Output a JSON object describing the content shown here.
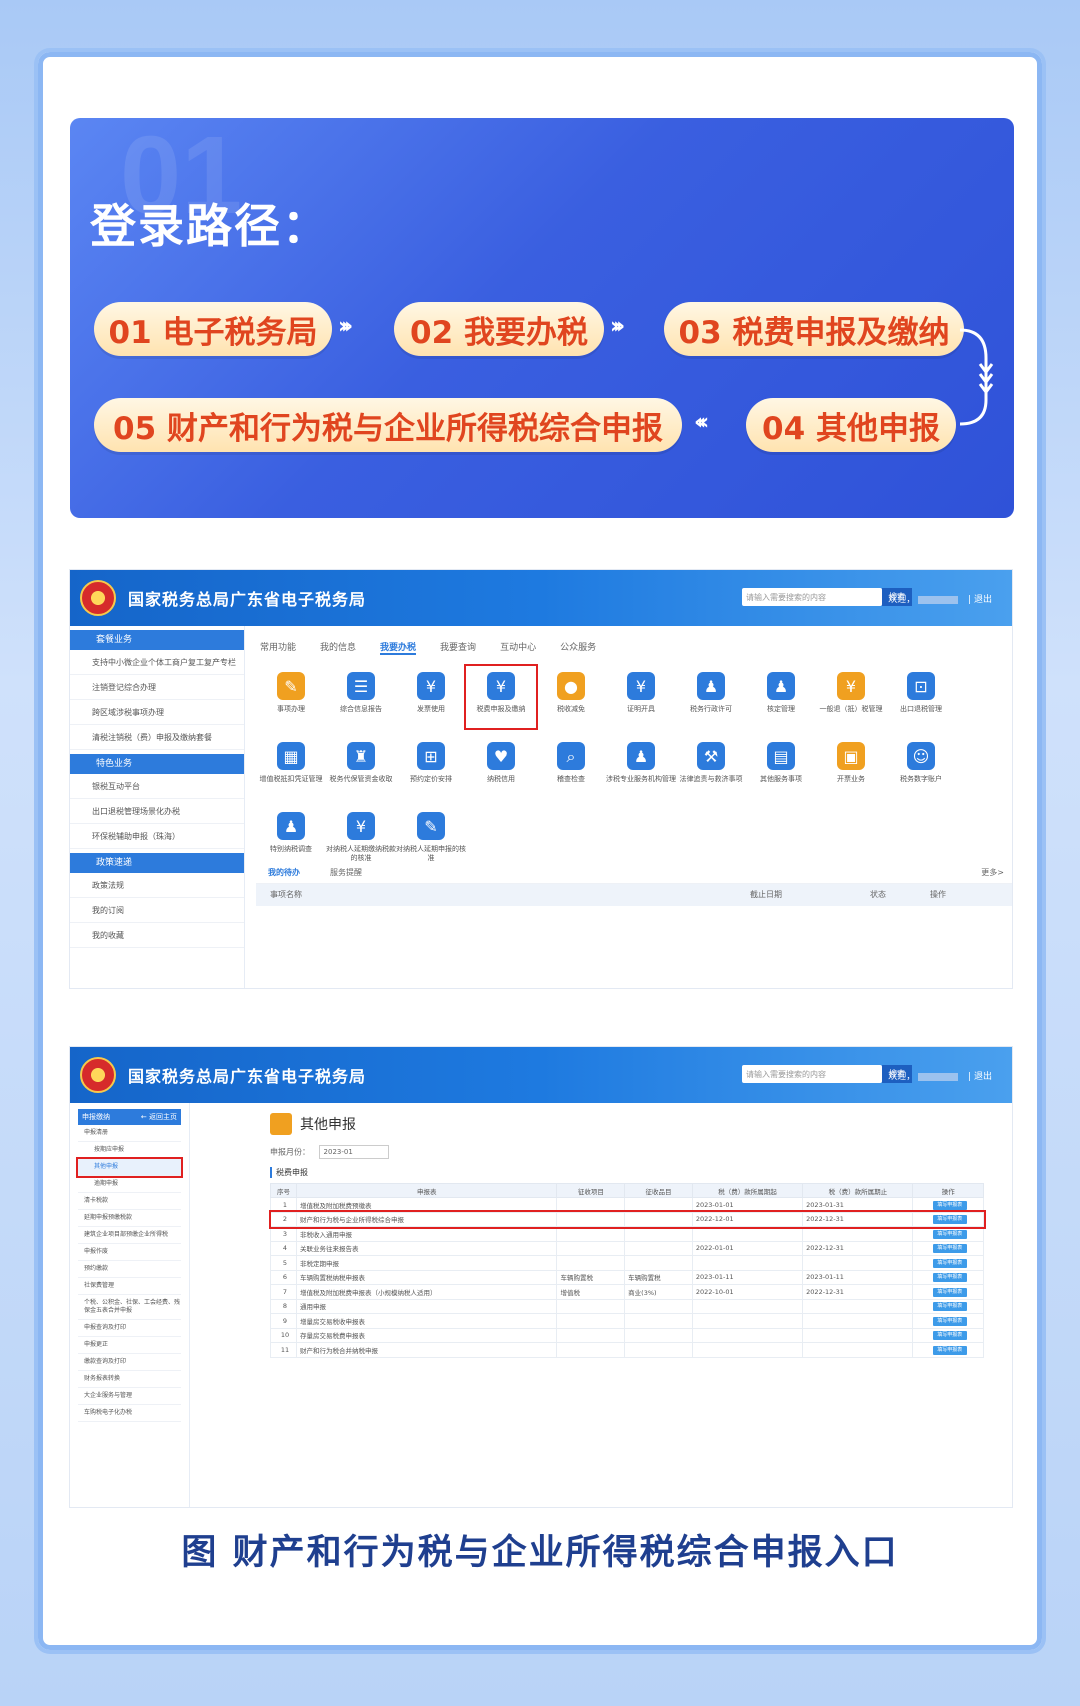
{
  "banner": {
    "watermark": "01",
    "title": "登录路径：",
    "steps": [
      "01 电子税务局",
      "02 我要办税",
      "03 税费申报及缴纳",
      "04 其他申报",
      "05 财产和行为税与企业所得税综合申报"
    ],
    "arrow": "›››"
  },
  "portal": {
    "site_name": "国家税务总局广东省电子税务局",
    "search_placeholder": "请输入需要搜索的内容",
    "search_button": "搜索",
    "welcome": "欢迎，",
    "logout": "| 退出"
  },
  "shot1": {
    "sections": [
      {
        "title": "套餐业务",
        "items": [
          "支持中小微企业个体工商户复工复产专栏",
          "注销登记综合办理",
          "跨区域涉税事项办理",
          "清税注销税（费）申报及缴纳套餐"
        ]
      },
      {
        "title": "特色业务",
        "items": [
          "银税互动平台",
          "出口退税管理场景化办税",
          "环保税辅助申报（珠海）"
        ]
      },
      {
        "title": "政策速递",
        "items": [
          "政策法规",
          "我的订阅",
          "我的收藏"
        ]
      }
    ],
    "tabs": [
      "常用功能",
      "我的信息",
      "我要办税",
      "我要查询",
      "互动中心",
      "公众服务"
    ],
    "active_tab": "我要办税",
    "grid": [
      {
        "label": "事项办理",
        "icon": "pen-icon",
        "color": "#f0a020"
      },
      {
        "label": "综合信息报告",
        "icon": "doc-icon",
        "color": "#2d7bdc"
      },
      {
        "label": "发票使用",
        "icon": "invoice-icon",
        "color": "#2d7bdc"
      },
      {
        "label": "税费申报及缴纳",
        "icon": "declare-icon",
        "color": "#2d7bdc"
      },
      {
        "label": "税收减免",
        "icon": "coin-icon",
        "color": "#f0a020"
      },
      {
        "label": "证明开具",
        "icon": "cert-icon",
        "color": "#2d7bdc"
      },
      {
        "label": "税务行政许可",
        "icon": "person-icon",
        "color": "#2d7bdc"
      },
      {
        "label": "核定管理",
        "icon": "user-gear-icon",
        "color": "#2d7bdc"
      },
      {
        "label": "一般退（抵）税管理",
        "icon": "refund-icon",
        "color": "#f0a020"
      },
      {
        "label": "出口退税管理",
        "icon": "export-icon",
        "color": "#2d7bdc"
      },
      {
        "label": "增值税抵扣凭证管理",
        "icon": "voucher-icon",
        "color": "#2d7bdc"
      },
      {
        "label": "税务代保管资金收取",
        "icon": "money-bag-icon",
        "color": "#2d7bdc"
      },
      {
        "label": "预约定价安排",
        "icon": "calendar-icon",
        "color": "#2d7bdc"
      },
      {
        "label": "纳税信用",
        "icon": "shield-icon",
        "color": "#2d7bdc"
      },
      {
        "label": "稽查检查",
        "icon": "search-person-icon",
        "color": "#2d7bdc"
      },
      {
        "label": "涉税专业服务机构管理",
        "icon": "agency-icon",
        "color": "#2d7bdc"
      },
      {
        "label": "法律追责与救济事项",
        "icon": "hammer-icon",
        "color": "#2d7bdc"
      },
      {
        "label": "其他服务事项",
        "icon": "clipboard-icon",
        "color": "#2d7bdc"
      },
      {
        "label": "开票业务",
        "icon": "print-icon",
        "color": "#f0a020"
      },
      {
        "label": "税务数字账户",
        "icon": "account-icon",
        "color": "#2d7bdc"
      },
      {
        "label": "特别纳税调查",
        "icon": "investigate-icon",
        "color": "#2d7bdc"
      },
      {
        "label": "对纳税人延期缴纳税款的核准",
        "icon": "deferral-icon",
        "color": "#2d7bdc"
      },
      {
        "label": "对纳税人延期申报的核准",
        "icon": "deferral-edit-icon",
        "color": "#2d7bdc"
      }
    ],
    "todo_tabs": [
      "我的待办",
      "服务提醒"
    ],
    "more": "更多>",
    "todo_headers": [
      "事项名称",
      "截止日期",
      "状态",
      "操作"
    ]
  },
  "shot2": {
    "side_header": "申报缴纳",
    "side_back": "← 返回主页",
    "side_items": [
      "申报清册",
      "按期应申报",
      "其他申报",
      "逾期申报",
      "清卡税款",
      "延期申报预缴税款",
      "建筑企业项目部预缴企业所得税",
      "申报作废",
      "预约缴款",
      "社保费管理",
      "个税、公积金、社保、工会经费、残保金五表合并申报",
      "申报查询及打印",
      "申报更正",
      "缴款查询及打印",
      "财务报表转换",
      "大企业服务与管理",
      "车购税电子化办税"
    ],
    "page_title": "其他申报",
    "month_label": "申报月份：",
    "month_value": "2023-01",
    "table_caption": "税费申报",
    "headers": [
      "序号",
      "申报表",
      "征收项目",
      "征收品目",
      "税（费）款所属期起",
      "税（费）款所属期止",
      "操作"
    ],
    "rows": [
      [
        "1",
        "增值税及附加税费预缴表",
        "",
        "",
        "2023-01-01",
        "2023-01-31"
      ],
      [
        "2",
        "财产和行为税与企业所得税综合申报",
        "",
        "",
        "2022-12-01",
        "2022-12-31"
      ],
      [
        "3",
        "非税收入通用申报",
        "",
        "",
        "",
        ""
      ],
      [
        "4",
        "关联业务往来报告表",
        "",
        "",
        "2022-01-01",
        "2022-12-31"
      ],
      [
        "5",
        "非税定期申报",
        "",
        "",
        "",
        ""
      ],
      [
        "6",
        "车辆购置税纳税申报表",
        "车辆购置税",
        "车辆购置税",
        "2023-01-11",
        "2023-01-11"
      ],
      [
        "7",
        "增值税及附加税费申报表（小规模纳税人适用）",
        "增值税",
        "商业(3%)",
        "2022-10-01",
        "2022-12-31"
      ],
      [
        "8",
        "通用申报",
        "",
        "",
        "",
        ""
      ],
      [
        "9",
        "增量房交易税收申报表",
        "",
        "",
        "",
        ""
      ],
      [
        "10",
        "存量房交易税费申报表",
        "",
        "",
        "",
        ""
      ],
      [
        "11",
        "财产和行为税合并纳税申报",
        "",
        "",
        "",
        ""
      ]
    ],
    "op_label": "填写申报表"
  },
  "caption": "图 财产和行为税与企业所得税综合申报入口"
}
